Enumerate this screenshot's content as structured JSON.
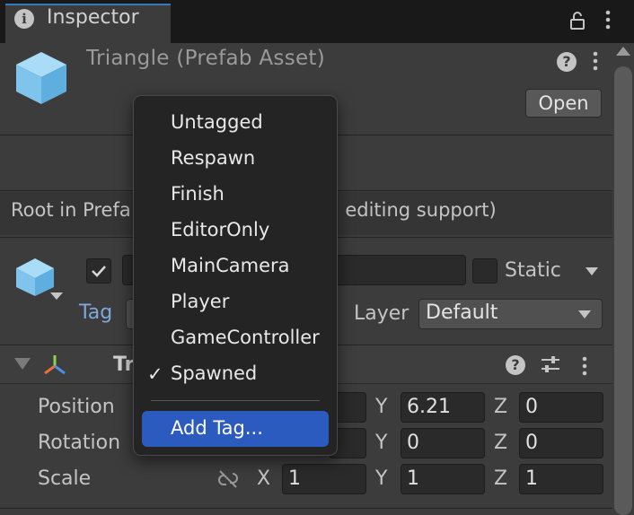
{
  "tab": {
    "title": "Inspector",
    "info_icon": "info-icon",
    "lock_icon": "lock-icon",
    "more_icon": "kebab-menu-icon"
  },
  "header": {
    "title": "Triangle (Prefab Asset)",
    "open_label": "Open",
    "icon": "prefab-cube-icon"
  },
  "root_info": {
    "text_left": "Root in Prefa",
    "text_right": "ll editing support)"
  },
  "gameobject": {
    "active_checked": true,
    "static_label": "Static",
    "tag_label": "Tag",
    "layer_label": "Layer",
    "layer_value": "Default"
  },
  "transform": {
    "title": "Tr",
    "rows": [
      {
        "label": "Position",
        "x": "",
        "y": "6.21",
        "z": "0"
      },
      {
        "label": "Rotation",
        "x": "",
        "y": "0",
        "z": "0"
      },
      {
        "label": "Scale",
        "x": "1",
        "y": "1",
        "z": "1"
      }
    ],
    "axis_x": "X",
    "axis_y": "Y",
    "axis_z": "Z"
  },
  "tag_menu": {
    "items": [
      "Untagged",
      "Respawn",
      "Finish",
      "EditorOnly",
      "MainCamera",
      "Player",
      "GameController",
      "Spawned"
    ],
    "selected": "Spawned",
    "check_glyph": "✓",
    "add_label": "Add Tag..."
  },
  "colors": {
    "accent": "#2c5bc0",
    "tag_label": "#7fa7de",
    "prefab_icon": "#7fc4ec"
  }
}
